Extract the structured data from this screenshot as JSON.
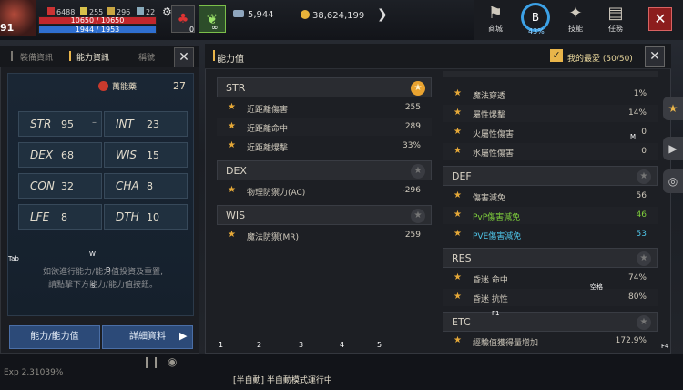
{
  "hud": {
    "level": "91",
    "stat1": "6488",
    "stat2": "255",
    "stat3": "296",
    "stat4": "22",
    "hp": "10650 / 10650",
    "mp": "1944 / 1953",
    "potion_count": "0",
    "leaf_label": "∞",
    "silver": "5,944",
    "gold": "38,624,199"
  },
  "top_menu": {
    "shop": "商城",
    "skill_pct": "43%",
    "skill_badge": "B",
    "skills": "技能",
    "quests": "任務"
  },
  "left_panel": {
    "tabs": [
      "裝備資訊",
      "能力資訊",
      "稱號"
    ],
    "class_name": "萬能藥",
    "bonus_points": "27",
    "stats": [
      {
        "name": "STR",
        "value": "95"
      },
      {
        "name": "INT",
        "value": "23"
      },
      {
        "name": "DEX",
        "value": "68"
      },
      {
        "name": "WIS",
        "value": "15"
      },
      {
        "name": "CON",
        "value": "32"
      },
      {
        "name": "CHA",
        "value": "8"
      },
      {
        "name": "LFE",
        "value": "8"
      },
      {
        "name": "DTH",
        "value": "10"
      }
    ],
    "hint_line1": "如欲進行能力/能力值投資及重置,",
    "hint_line2": "請點擊下方能力/能力值按鈕。",
    "btn_stats": "能力/能力值",
    "btn_details": "詳細資料",
    "key_tab": "Tab",
    "key_w": "W",
    "key_d": "D",
    "key_s": "S"
  },
  "right_panel": {
    "title": "能力值",
    "favorites": "我的最愛 (50/50)",
    "left_groups": [
      {
        "name": "STR",
        "fav": true,
        "rows": [
          {
            "label": "近距離傷害",
            "value": "255"
          },
          {
            "label": "近距離命中",
            "value": "289"
          },
          {
            "label": "近距離爆擊",
            "value": "33%"
          }
        ]
      },
      {
        "name": "DEX",
        "fav": false,
        "rows": [
          {
            "label": "物理防禦力(AC)",
            "value": "-296"
          }
        ]
      },
      {
        "name": "WIS",
        "fav": false,
        "rows": [
          {
            "label": "魔法防禦(MR)",
            "value": "259"
          }
        ]
      }
    ],
    "right_top_rows": [
      {
        "label": "魔法穿透",
        "value": "1%"
      },
      {
        "label": "屬性爆擊",
        "value": "14%"
      },
      {
        "label": "火屬性傷害",
        "value": "0"
      },
      {
        "label": "水屬性傷害",
        "value": "0"
      }
    ],
    "right_groups": [
      {
        "name": "DEF",
        "rows": [
          {
            "label": "傷害減免",
            "value": "56",
            "color": ""
          },
          {
            "label": "PvP傷害減免",
            "value": "46",
            "color": "green"
          },
          {
            "label": "PVE傷害減免",
            "value": "53",
            "color": "cyan"
          }
        ]
      },
      {
        "name": "RES",
        "rows": [
          {
            "label": "昏迷 命中",
            "value": "74%",
            "color": ""
          },
          {
            "label": "昏迷 抗性",
            "value": "80%",
            "color": ""
          }
        ]
      },
      {
        "name": "ETC",
        "rows": [
          {
            "label": "經驗值獲得量增加",
            "value": "172.9%",
            "color": ""
          }
        ]
      }
    ]
  },
  "overlay_keys": {
    "m": "M",
    "space": "空格",
    "f1": "F1",
    "f4": "F4",
    "slots": [
      "1",
      "2",
      "3",
      "4",
      "5"
    ]
  },
  "bottom": {
    "exp": "Exp  2.31039%",
    "auto": "[半自動] 半自動模式運行中"
  }
}
